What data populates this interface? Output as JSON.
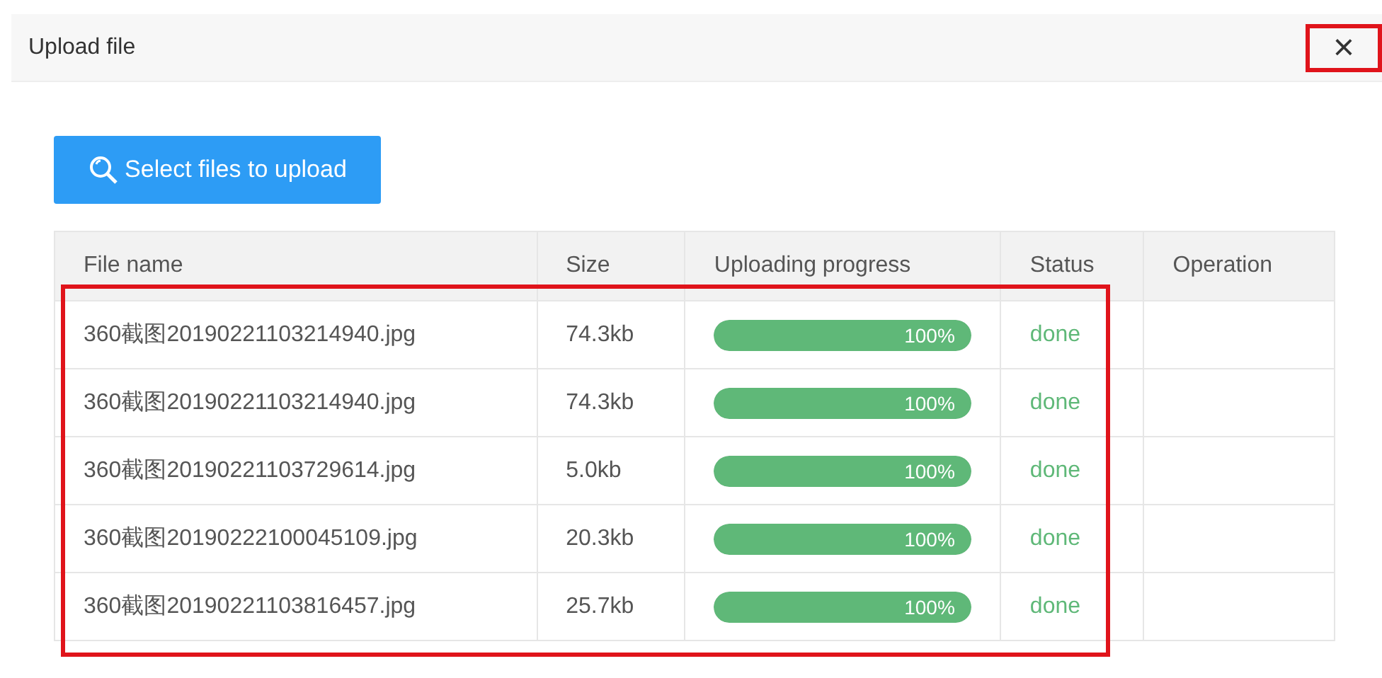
{
  "dialog": {
    "title": "Upload file",
    "close": "×"
  },
  "select_button": {
    "label": "Select files to upload"
  },
  "table": {
    "columns": [
      "File name",
      "Size",
      "Uploading progress",
      "Status",
      "Operation"
    ],
    "rows": [
      {
        "name": "360截图20190221103214940.jpg",
        "size": "74.3kb",
        "level": 1,
        "reading": "100%",
        "status": "done"
      },
      {
        "name": "360截图20190221103214940.jpg",
        "size": "74.3kb",
        "level": 1,
        "reading": "100%",
        "status": "done"
      },
      {
        "name": "360截图20190221103729614.jpg",
        "size": "5.0kb",
        "level": 1,
        "reading": "100%",
        "status": "done"
      },
      {
        "name": "360截图20190222100045109.jpg",
        "size": "20.3kb",
        "level": 1,
        "reading": "100%",
        "status": "done"
      },
      {
        "name": "360截图20190221103816457.jpg",
        "size": "25.7kb",
        "level": 1,
        "reading": "100%",
        "status": "done"
      }
    ]
  }
}
